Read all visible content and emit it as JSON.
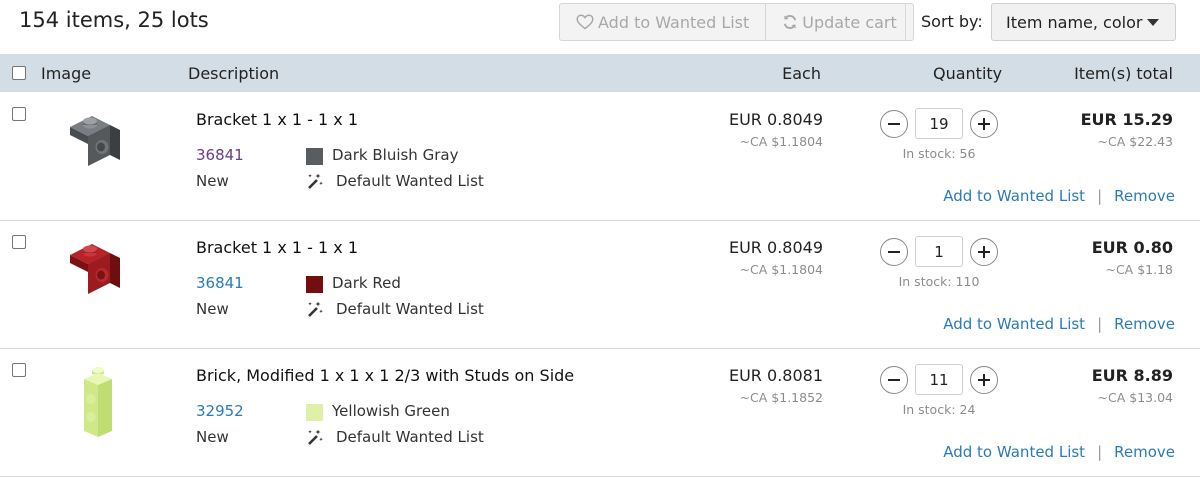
{
  "summary": {
    "count_text": "154 items, 25 lots"
  },
  "toolbar": {
    "add_wanted_label": "Add to Wanted List",
    "update_cart_label": "Update cart",
    "sort_label": "Sort by:",
    "sort_value": "Item name, color"
  },
  "table": {
    "headers": {
      "image": "Image",
      "description": "Description",
      "each": "Each",
      "quantity": "Quantity",
      "total": "Item(s) total"
    }
  },
  "rows": [
    {
      "name": "Bracket 1 x 1 - 1 x 1",
      "part_no": "36841",
      "color_name": "Dark Bluish Gray",
      "color_hex": "#595d60",
      "condition": "New",
      "wanted_list": "Default Wanted List",
      "each": "EUR 0.8049",
      "each_ca": "~CA $1.1804",
      "qty": "19",
      "stock": "In stock: 56",
      "total": "EUR 15.29",
      "total_ca": "~CA $22.43",
      "add_wanted": "Add to Wanted List",
      "remove": "Remove"
    },
    {
      "name": "Bracket 1 x 1 - 1 x 1",
      "part_no": "36841",
      "color_name": "Dark Red",
      "color_hex": "#720e0f",
      "condition": "New",
      "wanted_list": "Default Wanted List",
      "each": "EUR 0.8049",
      "each_ca": "~CA $1.1804",
      "qty": "1",
      "stock": "In stock: 110",
      "total": "EUR 0.80",
      "total_ca": "~CA $1.18",
      "add_wanted": "Add to Wanted List",
      "remove": "Remove"
    },
    {
      "name": "Brick, Modified 1 x 1 x 1 2/3 with Studs on Side",
      "part_no": "32952",
      "color_name": "Yellowish Green",
      "color_hex": "#dff0a8",
      "condition": "New",
      "wanted_list": "Default Wanted List",
      "each": "EUR 0.8081",
      "each_ca": "~CA $1.1852",
      "qty": "11",
      "stock": "In stock: 24",
      "total": "EUR 8.89",
      "total_ca": "~CA $13.04",
      "add_wanted": "Add to Wanted List",
      "remove": "Remove"
    }
  ],
  "colors": {
    "link": "#2a7ab8",
    "visited_link": "#6b3a8c",
    "header_bg": "#d3dde5",
    "muted": "#8c8c8c"
  },
  "icons": {
    "add_wanted": "heart-outline-icon",
    "update_cart": "refresh-icon",
    "sort": "caret-down-icon",
    "wanted_list": "magic-wand-icon",
    "qty_decrease": "minus-icon",
    "qty_increase": "plus-icon"
  }
}
